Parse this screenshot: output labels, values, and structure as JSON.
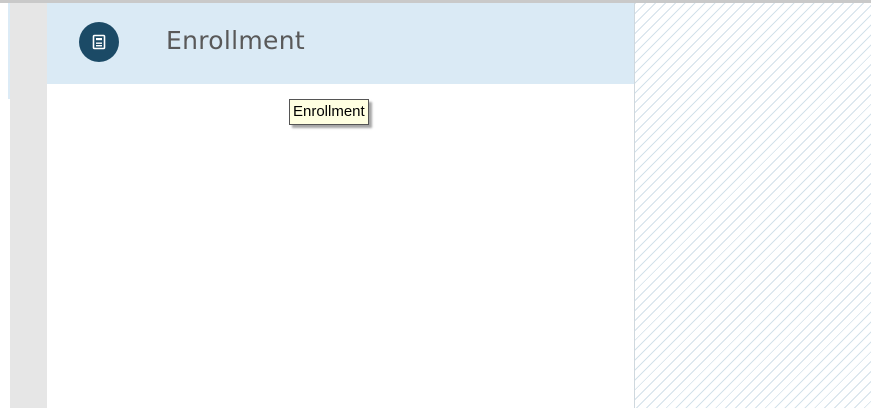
{
  "nav": {
    "items": [
      {
        "label": "Enrollment",
        "icon": "document-icon",
        "selected": true
      }
    ]
  },
  "tooltip": {
    "text": "Enrollment"
  },
  "colors": {
    "nav_item_selected_bg": "#daeaf5",
    "icon_circle": "#1b4a66",
    "label_text": "#595959",
    "tooltip_bg": "#ffffe1",
    "gutter": "#e6e6e6",
    "hatch_line": "#d3e1ea"
  }
}
